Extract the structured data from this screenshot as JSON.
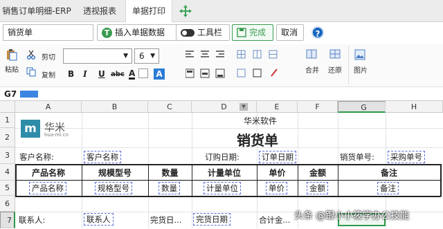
{
  "tabs": [
    {
      "label": "销售订单明细-ERP"
    },
    {
      "label": "透视报表"
    },
    {
      "label": "单据打印"
    }
  ],
  "toolbar": {
    "name_box": "销货单",
    "insert_label": "插入单据数据",
    "toolbar_label": "工具栏",
    "done_label": "完成",
    "cancel_label": "取消",
    "help": "?"
  },
  "ribbon": {
    "paste": "粘贴",
    "cut": "剪切",
    "copy": "复制",
    "font_size": "6",
    "bold": "B",
    "italic": "I",
    "underline": "U",
    "strike": "abc",
    "font_color": "A",
    "highlight": "A",
    "merge": "合并",
    "restore": "还原",
    "image": "图片"
  },
  "formula_bar": {
    "cell_ref": "G7"
  },
  "columns": [
    "A",
    "B",
    "C",
    "D",
    "E",
    "F",
    "G",
    "H"
  ],
  "rows": [
    "1",
    "2",
    "3",
    "4",
    "5",
    "6",
    "7"
  ],
  "sheet": {
    "logo_text": "华米",
    "logo_url": "huа-mi.cn",
    "company": "华米软件",
    "title": "销货单",
    "customer_label": "客户名称:",
    "customer_ph": "客户名称",
    "order_date_label": "订购日期:",
    "order_date_ph": "订单日期",
    "sales_no_label": "销货单号:",
    "sales_no_ph": "采购单号",
    "headers": [
      "产品名称",
      "规模型号",
      "数量",
      "计量单位",
      "单价",
      "金额",
      "备注"
    ],
    "placeholders": [
      "产品名称",
      "规格型号",
      "数量",
      "计量单位",
      "单价",
      "金额",
      "备注"
    ],
    "contact_label": "联系人:",
    "contact_ph": "联系人",
    "delivery_label": "完货日...",
    "delivery_ph": "完货日期",
    "total_label": "合计金..."
  },
  "watermark": "头条 @跟小小筱学办公技能",
  "colors": {
    "accent": "#2e9a4a",
    "help": "#1565c0",
    "placeholder_border": "#5a6bd8"
  }
}
